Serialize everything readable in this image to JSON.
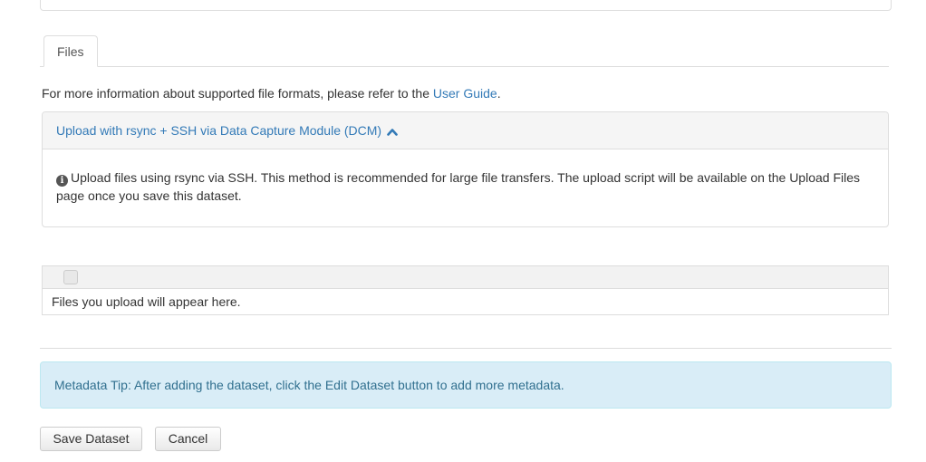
{
  "tabs": [
    {
      "label": "Files"
    }
  ],
  "info": {
    "text": "For more information about supported file formats, please refer to the ",
    "link": "User Guide",
    "suffix": "."
  },
  "dcm": {
    "title": "Upload with rsync + SSH via Data Capture Module (DCM)",
    "chevron_icon": "chevron-up-icon",
    "info_icon": "info-circle-icon",
    "body": "Upload files using rsync via SSH. This method is recommended for large file transfers. The upload script will be available on the Upload Files page once you save this dataset."
  },
  "files_table": {
    "empty_message": "Files you upload will appear here."
  },
  "metadata_tip": "Metadata Tip: After adding the dataset, click the Edit Dataset button to add more metadata.",
  "buttons": {
    "save": "Save Dataset",
    "cancel": "Cancel"
  },
  "colors": {
    "link": "#337ab7",
    "alert_bg": "#d9edf7",
    "alert_text": "#31708f"
  }
}
